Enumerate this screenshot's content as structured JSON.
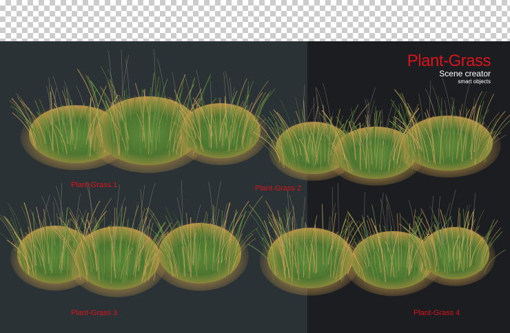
{
  "brand": {
    "title": "Plant-Grass",
    "subtitle": "Scene creator",
    "tagline": "smart objects",
    "accent_color": "#d8141c"
  },
  "captions": [
    "Plant-Grass 1",
    "Plant-Grass 2",
    "Plant-Grass 3",
    "Plant-Grass 4"
  ],
  "colors": {
    "panel_left": "#2b3235",
    "panel_right": "#1c1d21",
    "grass_green": "#4f7a33",
    "grass_gold": "#c49a4a"
  }
}
